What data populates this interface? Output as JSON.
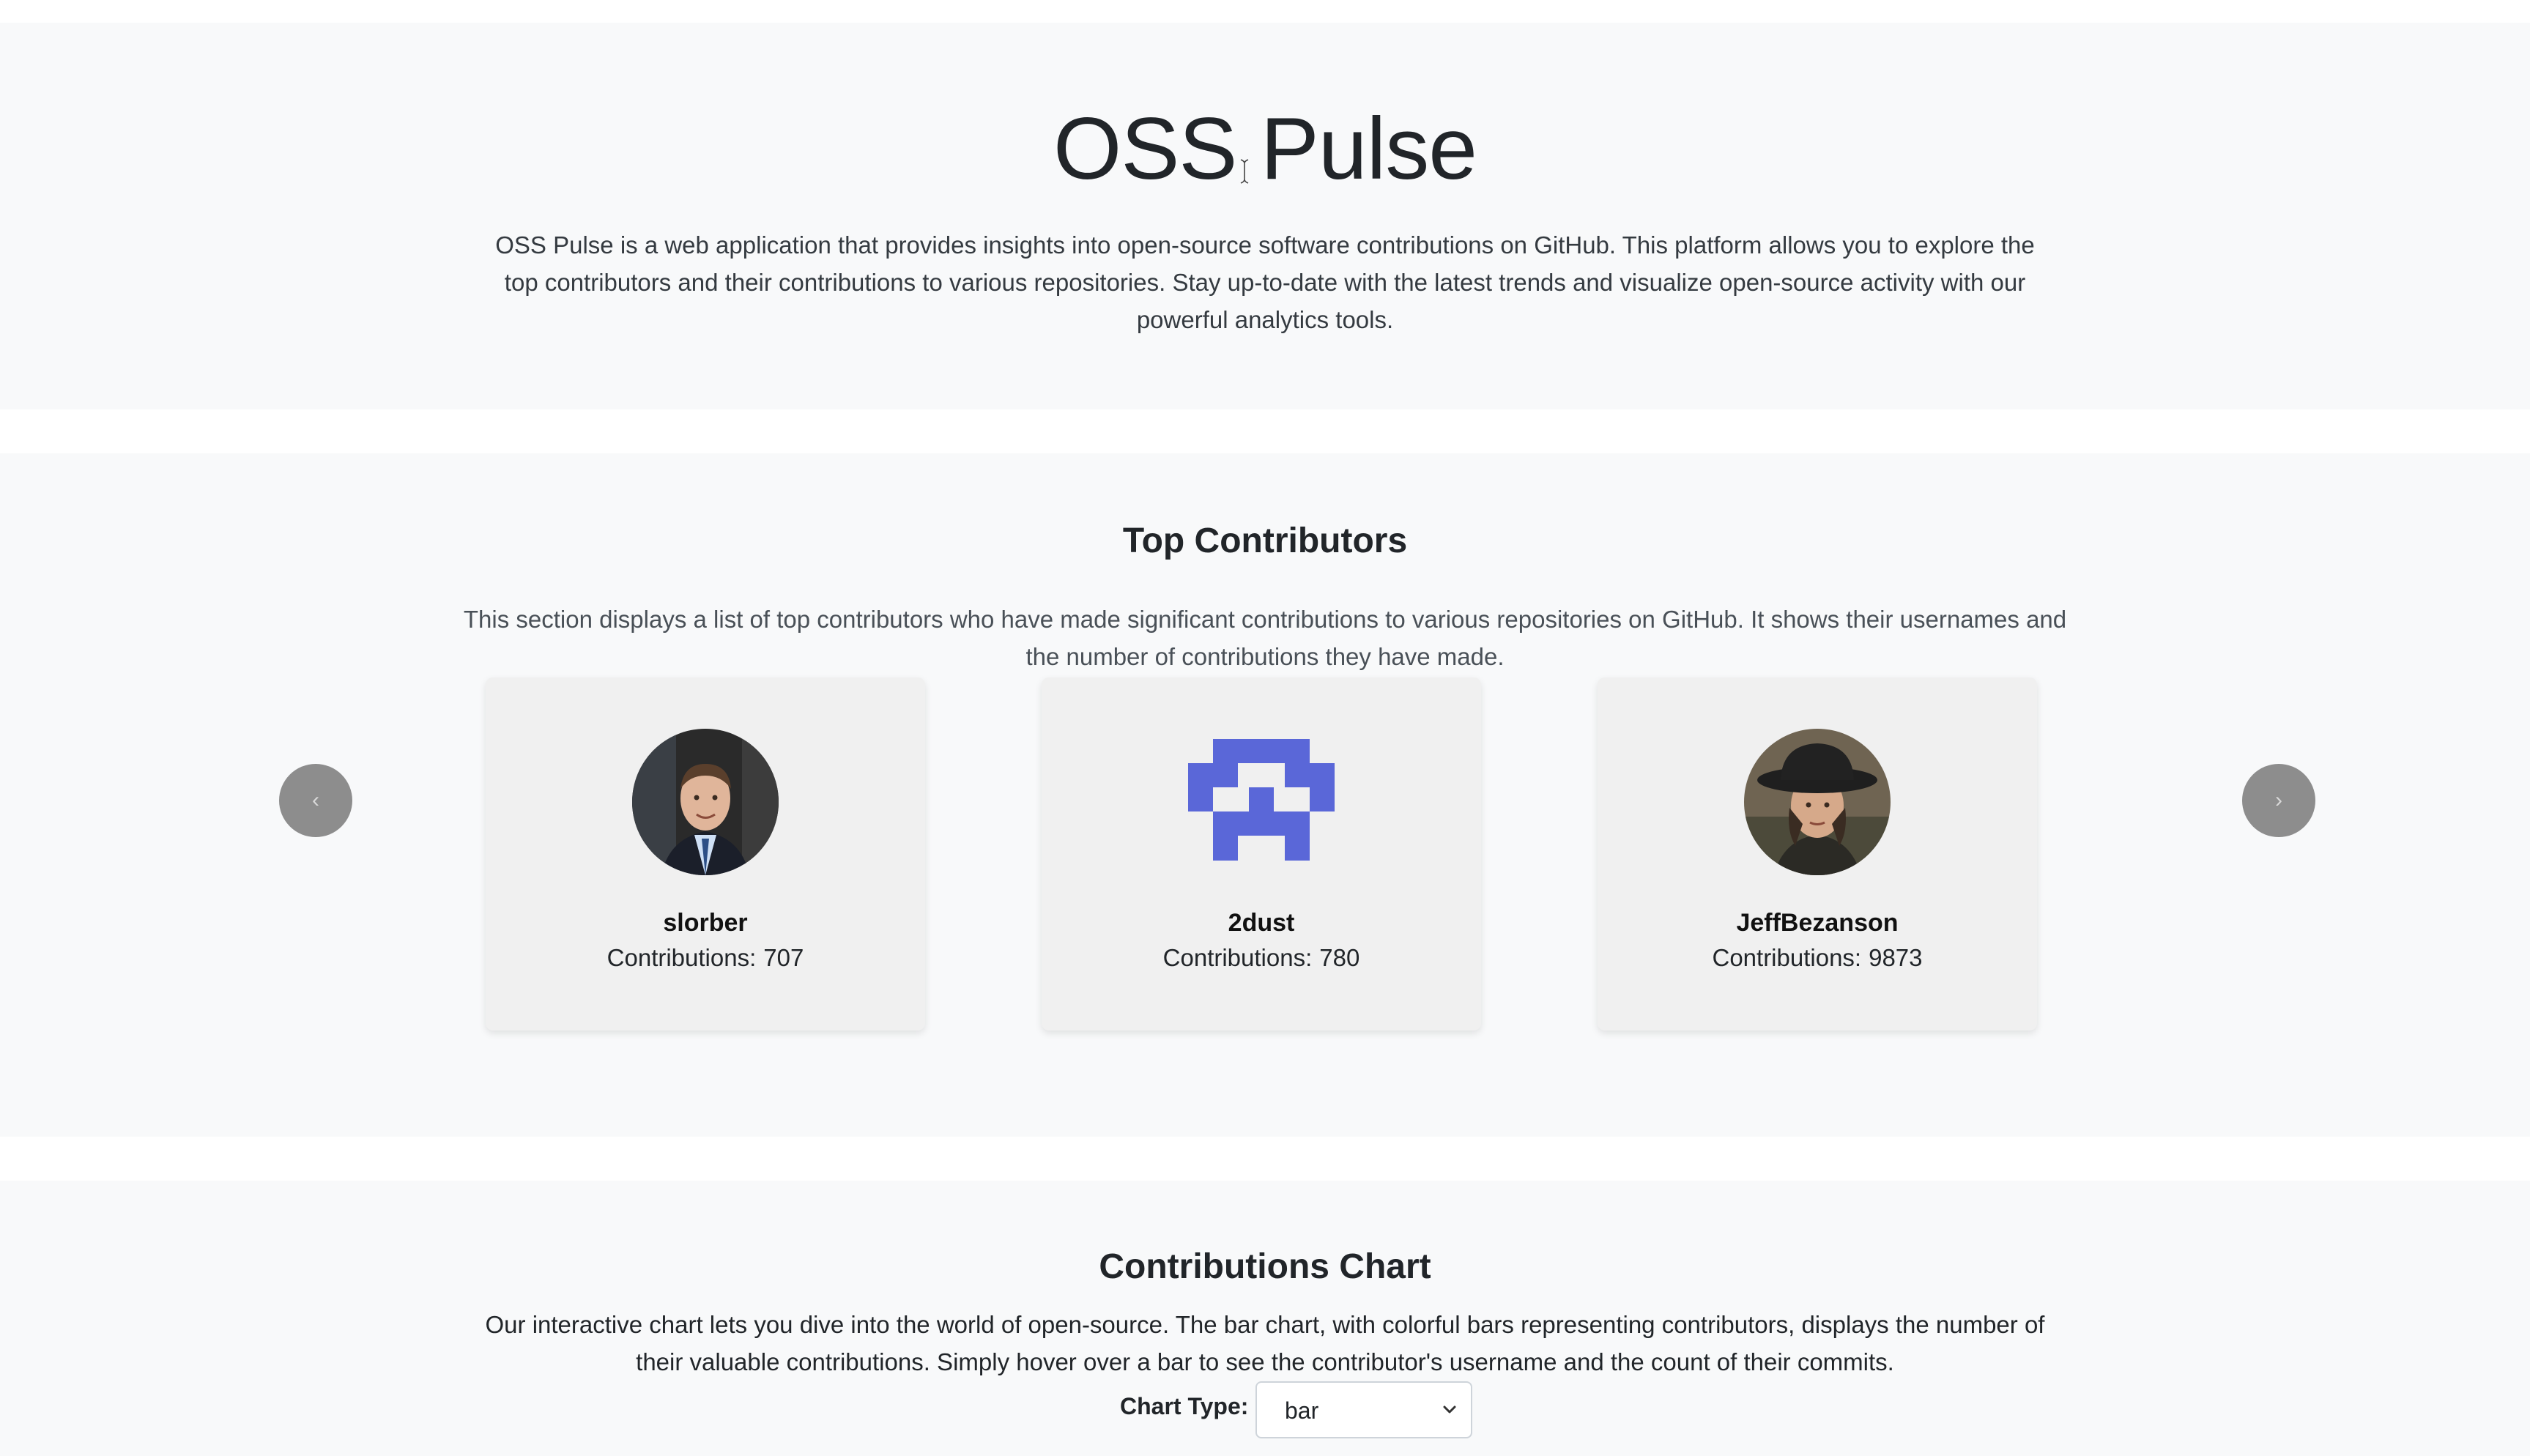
{
  "hero": {
    "title": "OSS Pulse",
    "description": "OSS Pulse is a web application that provides insights into open-source software contributions on GitHub. This platform allows you to explore the top contributors and their contributions to various repositories. Stay up-to-date with the latest trends and visualize open-source activity with our powerful analytics tools."
  },
  "contributors": {
    "title": "Top Contributors",
    "description": "This section displays a list of top contributors who have made significant contributions to various repositories on GitHub. It shows their usernames and the number of contributions they have made.",
    "prev_label": "‹",
    "next_label": "›",
    "cards": [
      {
        "username": "slorber",
        "contributions_label": "Contributions:",
        "contributions": "707"
      },
      {
        "username": "2dust",
        "contributions_label": "Contributions:",
        "contributions": "780"
      },
      {
        "username": "JeffBezanson",
        "contributions_label": "Contributions:",
        "contributions": "9873"
      }
    ]
  },
  "chart": {
    "title": "Contributions Chart",
    "description": "Our interactive chart lets you dive into the world of open-source. The bar chart, with colorful bars representing contributors, displays the number of their valuable contributions. Simply hover over a bar to see the contributor's username and the count of their commits.",
    "type_label": "Chart Type:",
    "type_value": "bar"
  },
  "colors": {
    "section_bg": "#f8f9fa",
    "card_bg": "#f0f0f0",
    "nav_button": "#8d8d8d",
    "identicon": "#5a67d8"
  }
}
